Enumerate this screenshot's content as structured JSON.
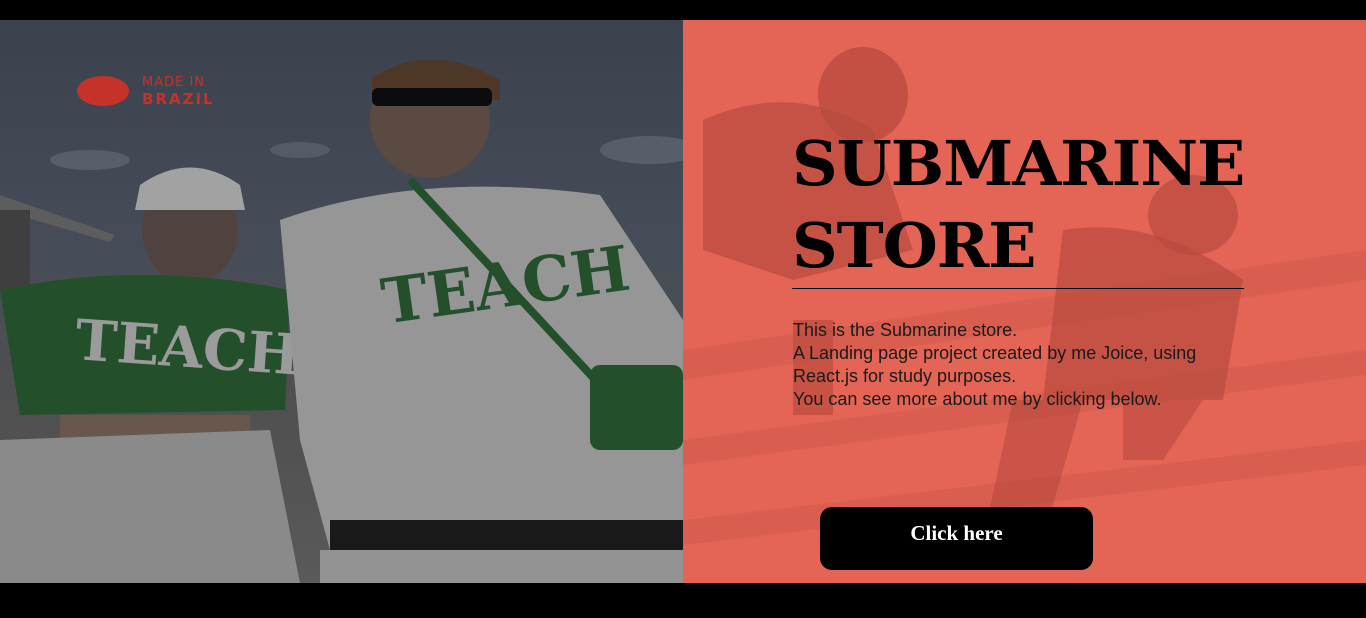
{
  "brand": {
    "logo_line1": "MADE IN",
    "logo_line2": "BRAZIL"
  },
  "hero": {
    "title": "SUBMARINE STORE",
    "description": [
      "This is the Submarine store.",
      "A Landing page project created by me Joice, using",
      "React.js for study purposes.",
      "You can see more about me by clicking below."
    ],
    "button_label": "Click here"
  },
  "colors": {
    "accent": "#e46555",
    "logo": "#c4322a",
    "button": "#000000"
  }
}
